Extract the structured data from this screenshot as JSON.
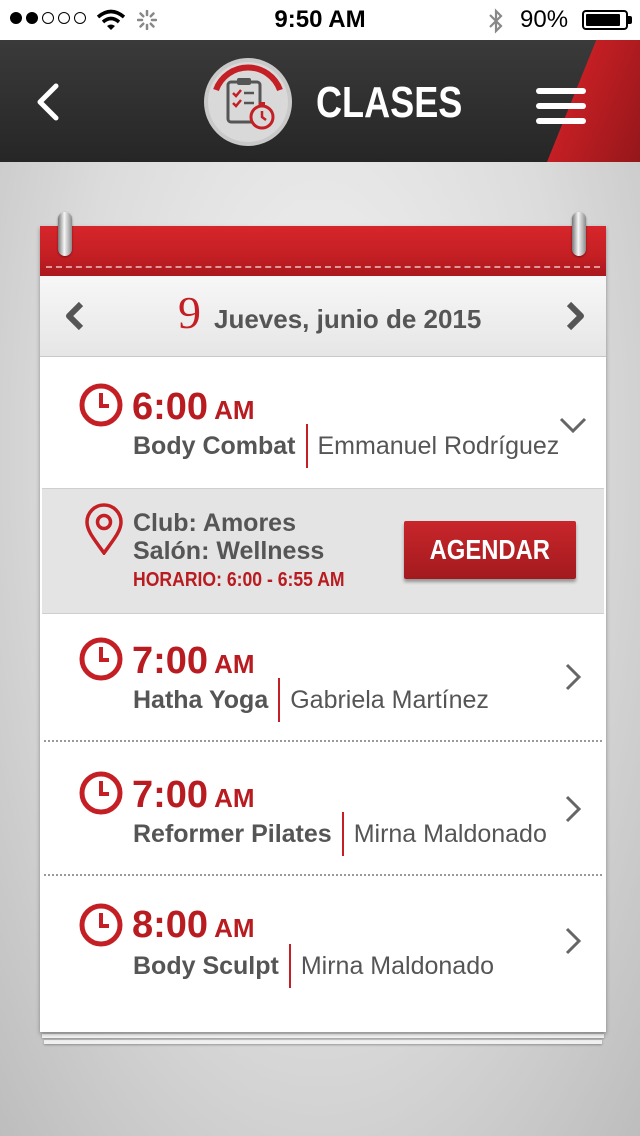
{
  "status_bar": {
    "signal_dots_filled": 2,
    "signal_dots_total": 5,
    "time": "9:50 AM",
    "battery_percent": "90%",
    "battery_level": 0.9
  },
  "nav": {
    "title": "CLASES",
    "logo_icon": "clipboard-stopwatch-icon",
    "accent_color": "#c41f24"
  },
  "calendar": {
    "day_number": "9",
    "date_label": "Jueves, junio de 2015"
  },
  "classes": [
    {
      "time": "6:00",
      "ampm": "AM",
      "name": "Body Combat",
      "instructor": "Emmanuel Rodríguez",
      "expanded": true
    },
    {
      "time": "7:00",
      "ampm": "AM",
      "name": "Hatha Yoga",
      "instructor": "Gabriela Martínez",
      "expanded": false
    },
    {
      "time": "7:00",
      "ampm": "AM",
      "name": "Reformer Pilates",
      "instructor": "Mirna Maldonado",
      "expanded": false
    },
    {
      "time": "8:00",
      "ampm": "AM",
      "name": "Body Sculpt",
      "instructor": "Mirna Maldonado",
      "expanded": false
    }
  ],
  "detail": {
    "club": "Club: Amores",
    "salon": "Salón: Wellness",
    "horario": "HORARIO: 6:00 - 6:55 AM",
    "button_label": "AGENDAR"
  }
}
